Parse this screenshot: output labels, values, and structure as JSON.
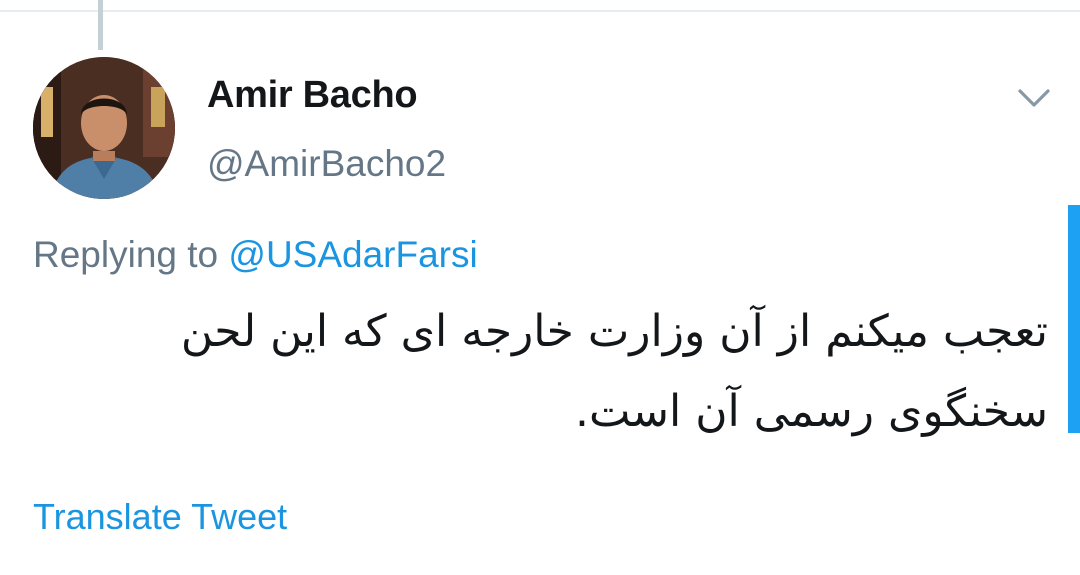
{
  "tweet": {
    "author": {
      "display_name": "Amir Bacho",
      "handle": "@AmirBacho2"
    },
    "replying_prefix": "Replying to",
    "replying_mention": "@USAdarFarsi",
    "text": "تعجب میکنم از آن وزارت خارجه ای که این لحن سخنگوی رسمی آن است.",
    "translate_label": "Translate Tweet"
  },
  "icons": {
    "menu": "chevron-down-icon"
  },
  "colors": {
    "name": "#14171a",
    "secondary": "#657786",
    "link": "#1b95e0",
    "accent": "#1da1f2"
  }
}
